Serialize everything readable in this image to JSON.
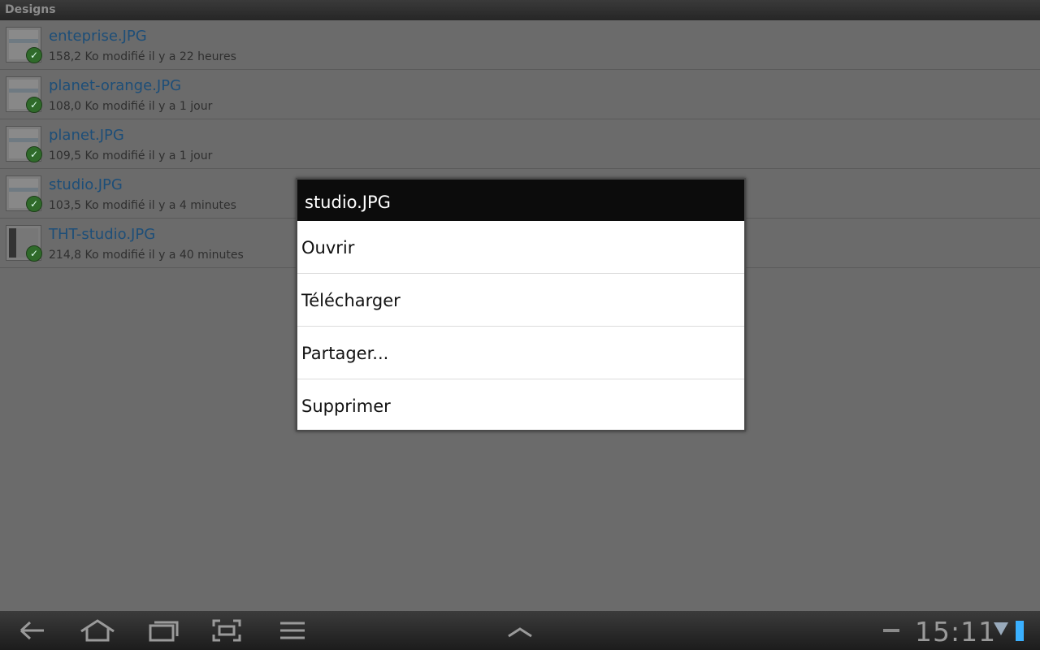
{
  "app": {
    "title": "Designs"
  },
  "files": [
    {
      "name": "enteprise.JPG",
      "meta": "158,2 Ko modifié il y a 22 heures"
    },
    {
      "name": "planet-orange.JPG",
      "meta": "108,0 Ko modifié il y a 1 jour"
    },
    {
      "name": "planet.JPG",
      "meta": "109,5 Ko modifié il y a 1 jour"
    },
    {
      "name": "studio.JPG",
      "meta": "103,5 Ko modifié il y a 4 minutes"
    },
    {
      "name": "THT-studio.JPG",
      "meta": "214,8 Ko modifié il y a 40 minutes"
    }
  ],
  "dialog": {
    "title": "studio.JPG",
    "items": [
      "Ouvrir",
      "Télécharger",
      "Partager...",
      "Supprimer"
    ]
  },
  "systembar": {
    "time": "15:11",
    "icons": [
      "back-icon",
      "home-icon",
      "recent-apps-icon",
      "screenshot-icon",
      "menu-icon",
      "chevron-up-icon",
      "signal-icon",
      "battery-icon"
    ]
  },
  "colors": {
    "accent": "#1d4e78",
    "dialog_title_bg": "#0c0c0c",
    "dim_overlay": "#6b6b6b",
    "sync_check": "#2f6a2a"
  }
}
